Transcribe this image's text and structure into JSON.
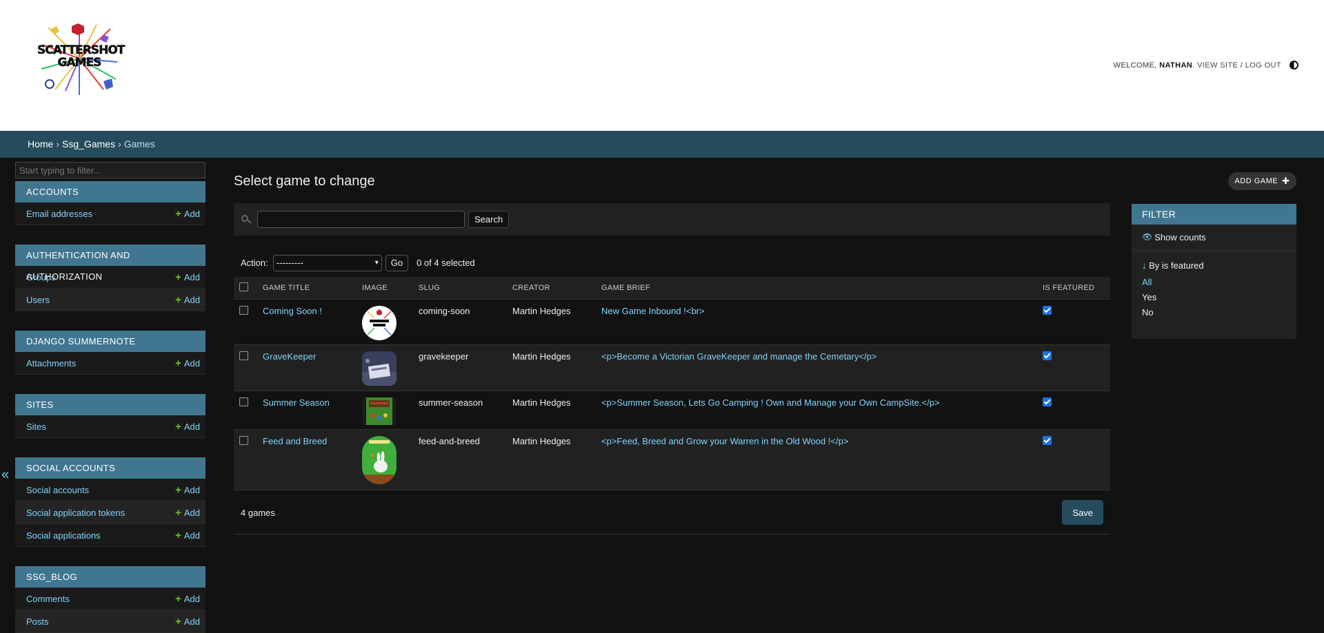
{
  "header": {
    "logo_line1": "SCATTERSHOT",
    "logo_line2": "GAMES",
    "welcome": "Welcome,",
    "username": "Nathan",
    "view_site": "View site",
    "separator": "/",
    "log_out": "Log out"
  },
  "breadcrumbs": {
    "home": "Home",
    "app": "Ssg_Games",
    "current": "Games",
    "sep": "›"
  },
  "sidebar": {
    "filter_placeholder": "Start typing to filter...",
    "add_label": "Add",
    "modules": [
      {
        "title": "Accounts",
        "items": [
          "Email addresses"
        ]
      },
      {
        "title": "Authentication and Authorization",
        "items": [
          "Groups",
          "Users"
        ]
      },
      {
        "title": "Django Summernote",
        "items": [
          "Attachments"
        ]
      },
      {
        "title": "Sites",
        "items": [
          "Sites"
        ]
      },
      {
        "title": "Social Accounts",
        "items": [
          "Social accounts",
          "Social application tokens",
          "Social applications"
        ]
      },
      {
        "title": "Ssg_Blog",
        "items": [
          "Comments",
          "Posts"
        ]
      }
    ],
    "collapse_icon": "«"
  },
  "content": {
    "title": "Select game to change",
    "add_button": "Add Game",
    "search_button": "Search",
    "search_value": "",
    "action_label": "Action:",
    "action_selected": "---------",
    "go_button": "Go",
    "action_counter": "0 of 4 selected",
    "columns": [
      "Game title",
      "Image",
      "Slug",
      "Creator",
      "Game brief",
      "Is featured"
    ],
    "rows": [
      {
        "title": "Coming Soon !",
        "slug": "coming-soon",
        "creator": "Martin Hedges",
        "brief": "New Game Inbound !<br>",
        "featured": true
      },
      {
        "title": "GraveKeeper",
        "slug": "gravekeeper",
        "creator": "Martin Hedges",
        "brief": "<p>Become a Victorian GraveKeeper and manage the Cemetary</p>",
        "featured": true
      },
      {
        "title": "Summer Season",
        "slug": "summer-season",
        "creator": "Martin Hedges",
        "brief": "<p>Summer Season, Lets Go Camping ! Own and Manage your Own CampSite.</p>",
        "featured": true
      },
      {
        "title": "Feed and Breed",
        "slug": "feed-and-breed",
        "creator": "Martin Hedges",
        "brief": "<p>Feed, Breed and Grow your Warren in the Old Wood !</p>",
        "featured": true
      }
    ],
    "result_count": "4 games",
    "save_button": "Save"
  },
  "filter": {
    "title": "Filter",
    "show_counts": "Show counts",
    "by_label": "By is featured",
    "options": [
      "All",
      "Yes",
      "No"
    ],
    "selected": "All"
  },
  "colors": {
    "header_bg": "#ffffff",
    "breadcrumb_bg": "#264b5d",
    "module_head": "#417690",
    "link": "#81d4fa",
    "add_green": "#70bf2b",
    "checkbox_checked": "#1a73e8"
  }
}
